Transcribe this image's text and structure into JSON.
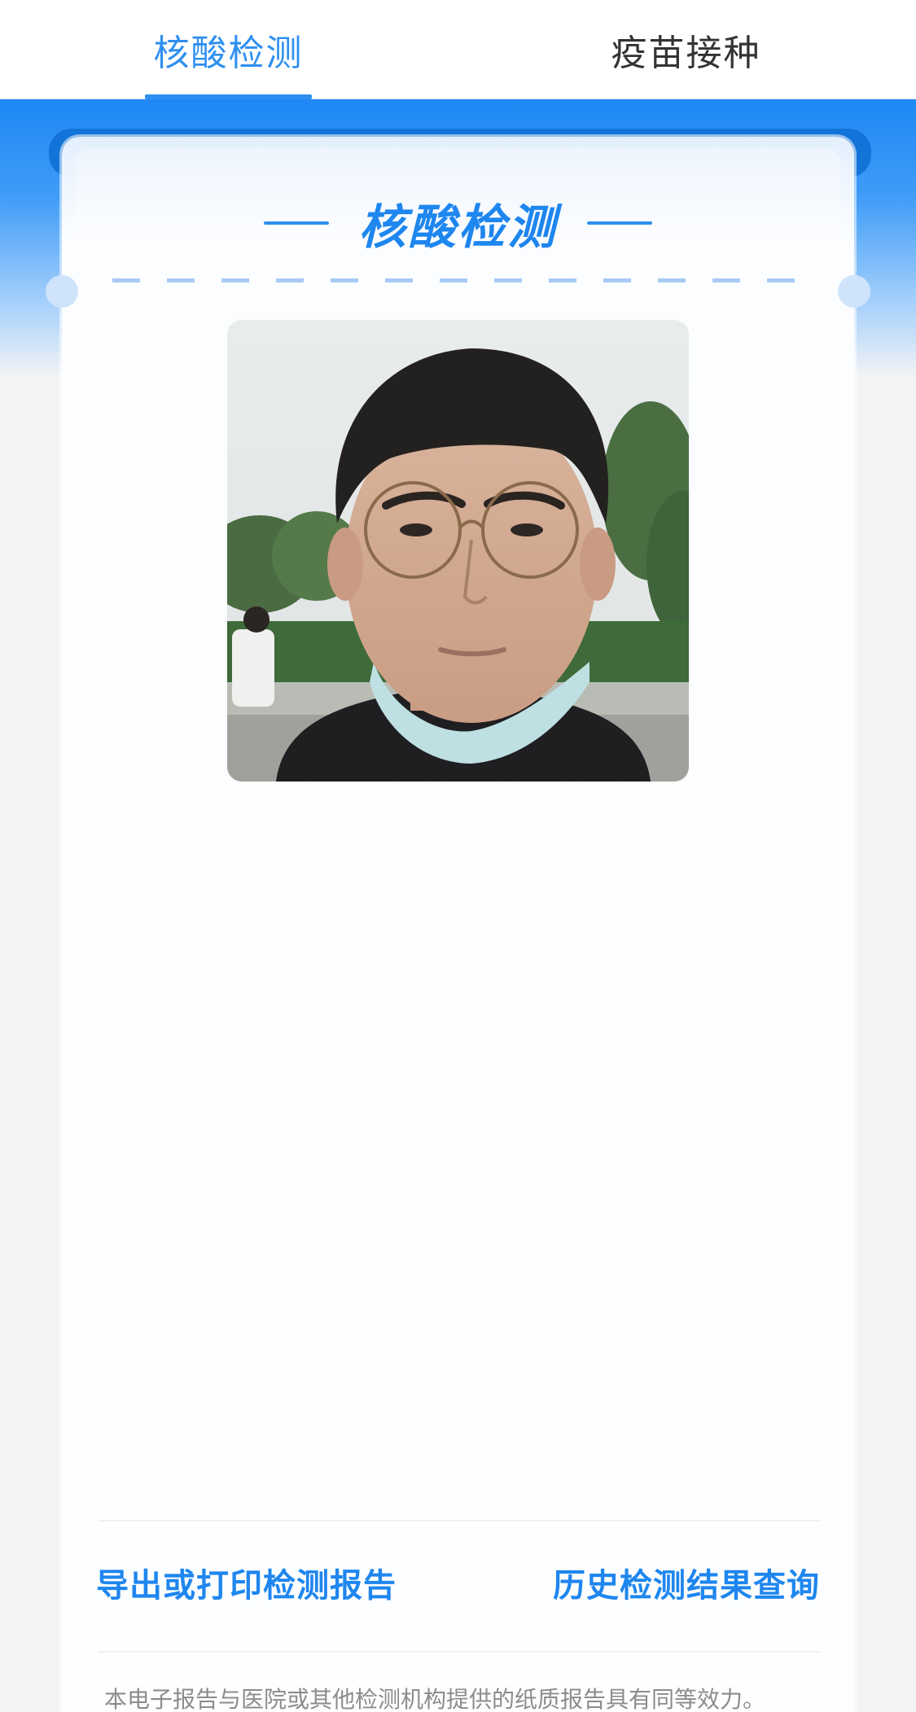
{
  "tabs": {
    "nucleic": "核酸检测",
    "vaccine": "疫苗接种",
    "active": "nucleic"
  },
  "card": {
    "title": "核酸检测"
  },
  "photo": {
    "subject": "portrait of a man with round glasses and a face mask pulled down, outdoors with trees and hedges"
  },
  "actions": {
    "export_label": "导出或打印检测报告",
    "history_label": "历史检测结果查询"
  },
  "notice": "本电子报告与医院或其他检测机构提供的纸质报告具有同等效力。",
  "colors": {
    "accent": "#1e86ef",
    "band_top": "#1e88f5",
    "background": "#f2f3f5"
  }
}
